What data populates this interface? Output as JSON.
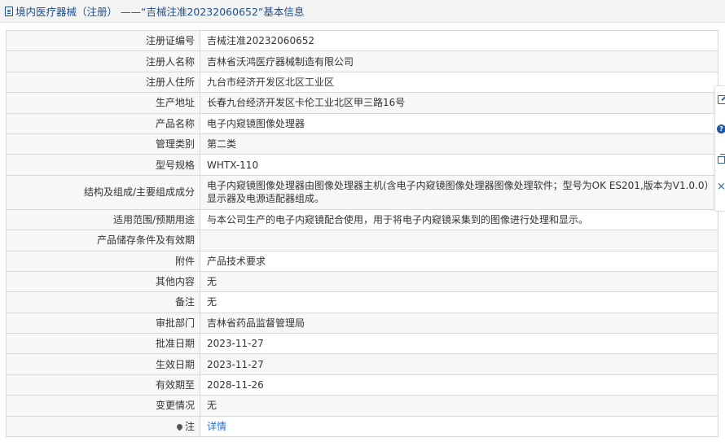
{
  "header": {
    "title": "境内医疗器械（注册） ——“吉械注准20232060652”基本信息"
  },
  "rows": [
    {
      "label": "注册证编号",
      "value": "吉械注准20232060652"
    },
    {
      "label": "注册人名称",
      "value": "吉林省沃鸿医疗器械制造有限公司"
    },
    {
      "label": "注册人住所",
      "value": "九台市经济开发区北区工业区"
    },
    {
      "label": "生产地址",
      "value": "长春九台经济开发区卡伦工业北区甲三路16号"
    },
    {
      "label": "产品名称",
      "value": "电子内窥镜图像处理器"
    },
    {
      "label": "管理类别",
      "value": "第二类"
    },
    {
      "label": "型号规格",
      "value": "WHTX-110"
    },
    {
      "label": "结构及组成/主要组成成分",
      "value": "电子内窥镜图像处理器由图像处理器主机(含电子内窥镜图像处理器图像处理软件；型号为OK ES201,版本为V1.0.0）显示器及电源适配器组成。"
    },
    {
      "label": "适用范围/预期用途",
      "value": "与本公司生产的电子内窥镜配合使用，用于将电子内窥镜采集到的图像进行处理和显示。"
    },
    {
      "label": "产品储存条件及有效期",
      "value": ""
    },
    {
      "label": "附件",
      "value": "产品技术要求"
    },
    {
      "label": "其他内容",
      "value": "无"
    },
    {
      "label": "备注",
      "value": "无"
    },
    {
      "label": "审批部门",
      "value": "吉林省药品监督管理局"
    },
    {
      "label": "批准日期",
      "value": "2023-11-27"
    },
    {
      "label": "生效日期",
      "value": "2023-11-27"
    },
    {
      "label": "有效期至",
      "value": "2028-11-26"
    },
    {
      "label": "变更情况",
      "value": "无"
    }
  ],
  "note": {
    "label": "注",
    "link": "详情"
  },
  "toolbar": {
    "edit_icon": "edit-icon",
    "help_icon": "help-icon",
    "help_glyph": "?",
    "copy_icon": "copy-icon",
    "close_icon": "close-icon",
    "close_glyph": "×"
  }
}
